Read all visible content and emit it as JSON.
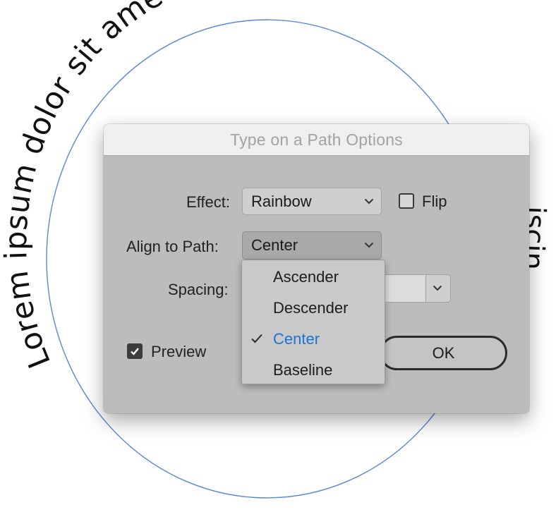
{
  "path_text": {
    "text": "Lorem ipsum dolor sit amet, consectetur adipiscing elit, sed do eiusmod tempor",
    "visible_fragment": "Lorem ipsum dolor sit amet, consectetu",
    "right_side_fragment": "iscin",
    "circle_color": "#5b86d9"
  },
  "dialog": {
    "title": "Type on a Path Options",
    "effect": {
      "label": "Effect:",
      "value": "Rainbow"
    },
    "flip": {
      "label": "Flip",
      "checked": false
    },
    "align_to_path": {
      "label": "Align to Path:",
      "value": "Center"
    },
    "spacing": {
      "label": "Spacing:",
      "value": ""
    },
    "preview": {
      "label": "Preview",
      "checked": true
    },
    "ok_label": "OK",
    "menu": {
      "items": [
        "Ascender",
        "Descender",
        "Center",
        "Baseline"
      ],
      "selected": "Center",
      "selected_color": "#1c74d8"
    }
  }
}
